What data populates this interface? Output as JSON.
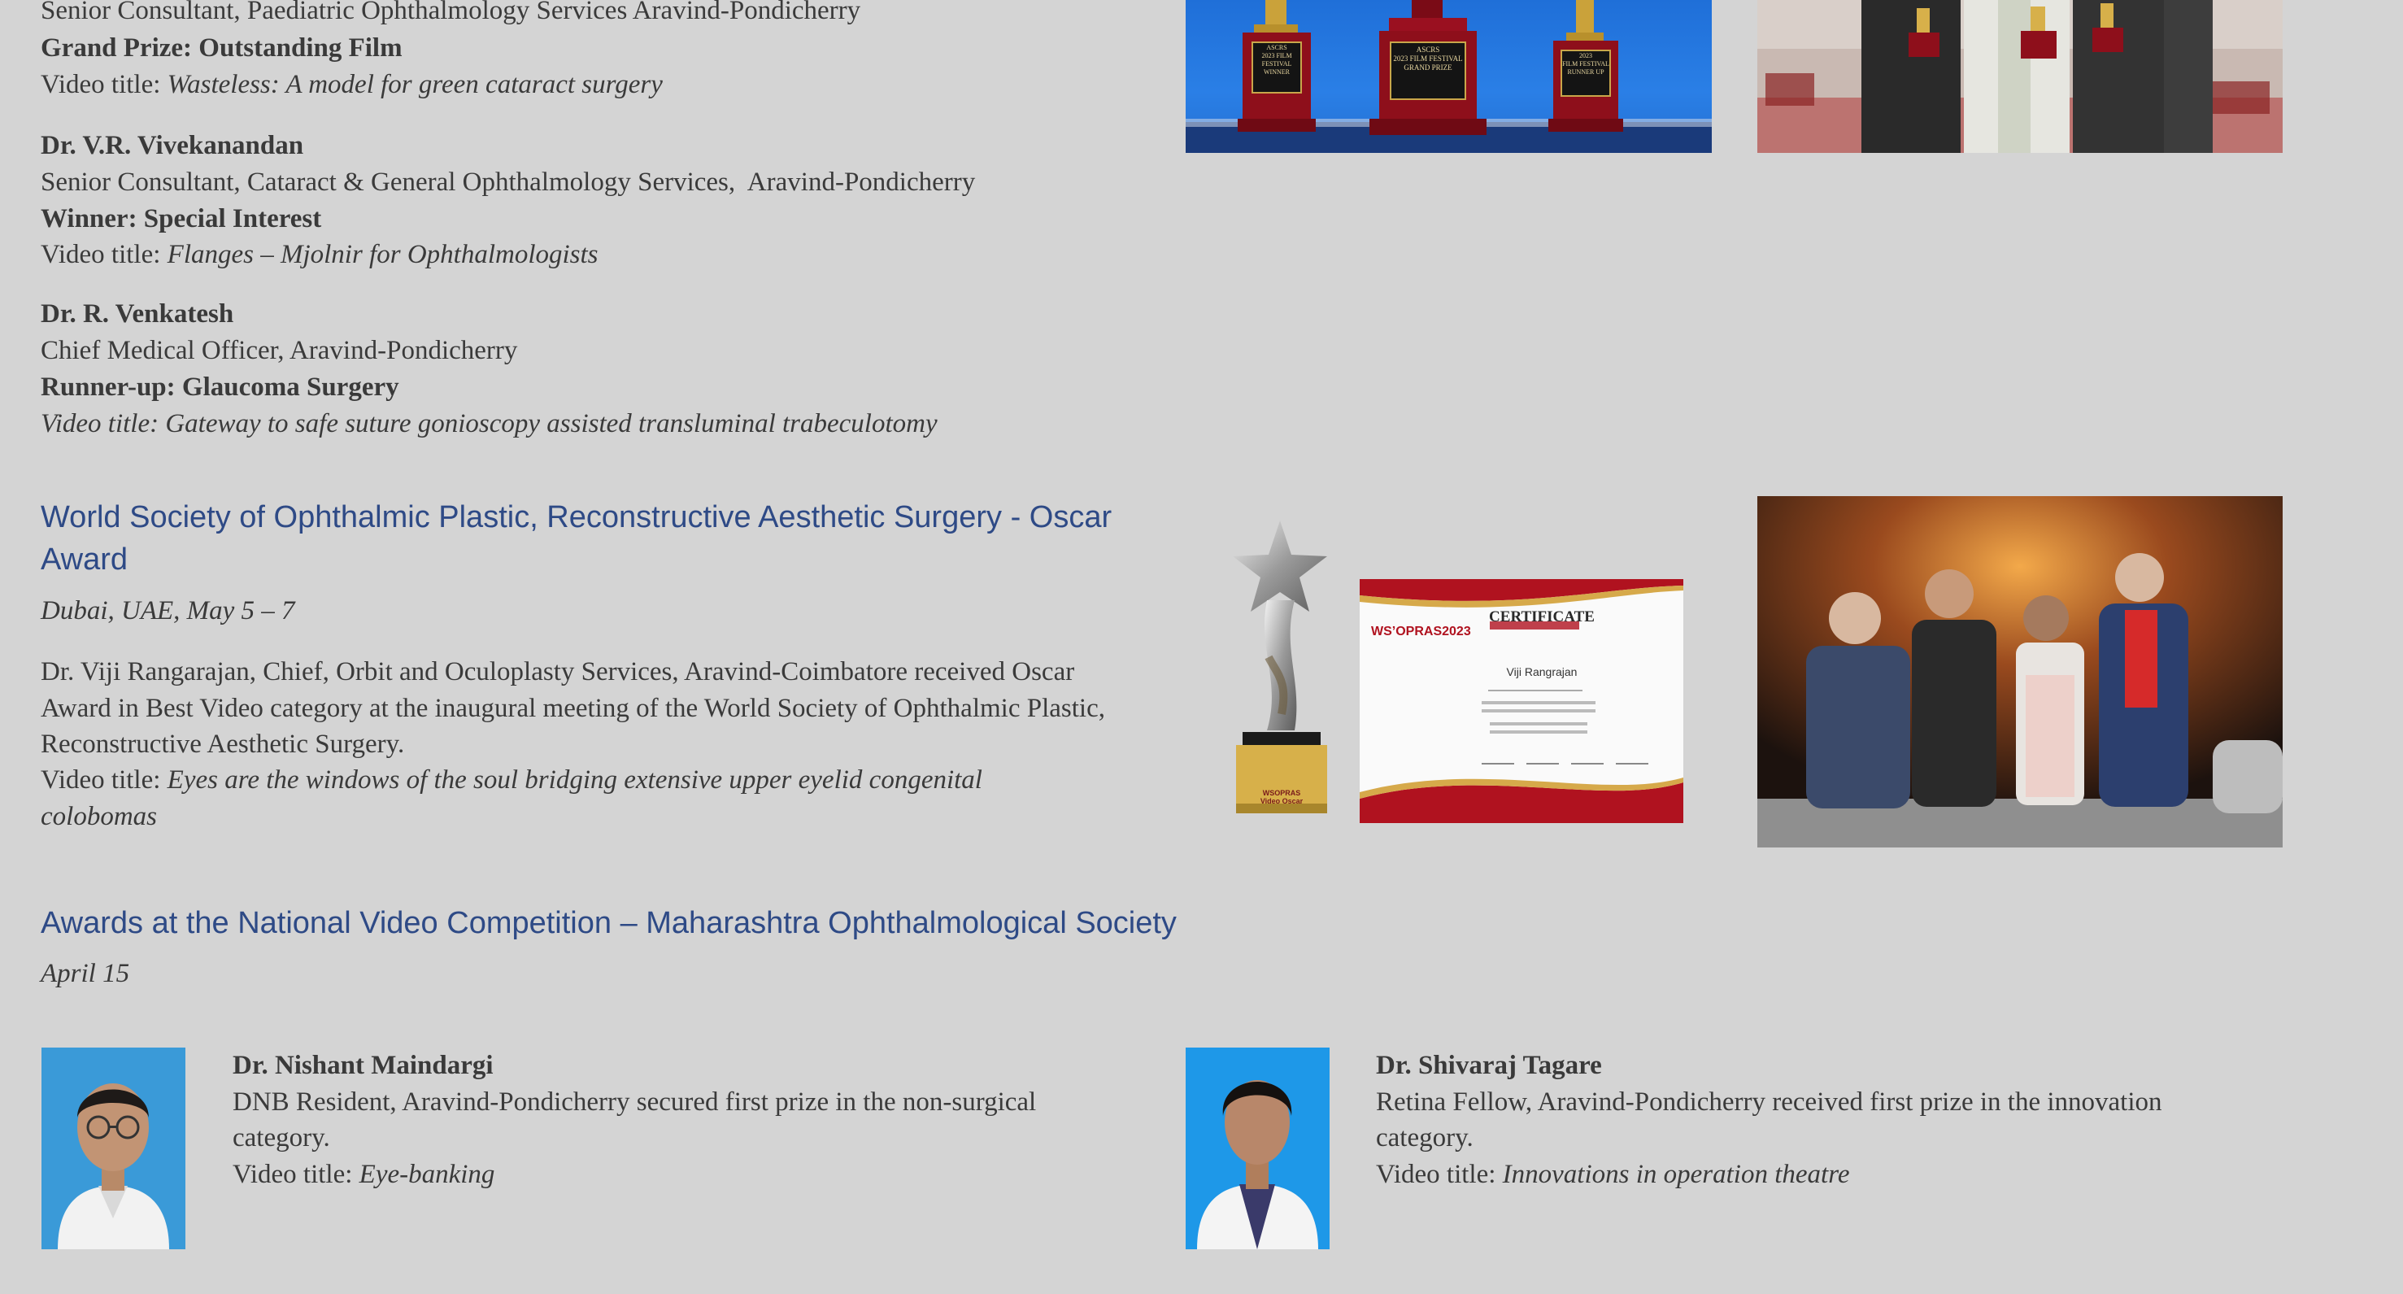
{
  "top_block": {
    "line0": "Senior Consultant, Paediatric Ophthalmology Services Aravind-Pondicherry",
    "prize_label": "Grand Prize: Outstanding Film",
    "video_prefix": "Video title: ",
    "video_title": "Wasteless: A model for green cataract surgery"
  },
  "vivekanandan": {
    "name": "Dr. V.R. Vivekanandan",
    "role": "Senior Consultant, Cataract & General Ophthalmology Services,  Aravind-Pondicherry",
    "prize_label": "Winner: Special Interest",
    "video_prefix": "Video title: ",
    "video_title": "Flanges – Mjolnir for Ophthalmologists"
  },
  "venkatesh": {
    "name": "Dr. R. Venkatesh",
    "role": "Chief Medical Officer, Aravind-Pondicherry",
    "prize_label": "Runner-up: Glaucoma Surgery",
    "video_line": "Video title: Gateway to safe suture gonioscopy assisted transluminal trabeculotomy"
  },
  "trophies_photo": {
    "plaque_left": [
      "ASCRS",
      "2023 FILM FESTIVAL",
      "WINNER"
    ],
    "plaque_center": [
      "ASCRS",
      "2023 FILM FESTIVAL",
      "GRAND PRIZE"
    ],
    "plaque_right": [
      "2023",
      "FILM FESTIVAL",
      "RUNNER UP"
    ]
  },
  "wsoprs": {
    "heading_line1": "World Society of Ophthalmic Plastic, Reconstructive Aesthetic Surgery - Oscar",
    "heading_line2": "Award",
    "place": "Dubai, UAE, May 5 – 7",
    "body": "Dr. Viji Rangarajan, Chief, Orbit and Oculoplasty Services, Aravind-Coimbatore received Oscar Award in Best Video category at the inaugural meeting of the World Society of Ophthalmic Plastic, Reconstructive Aesthetic Surgery.",
    "video_prefix": "Video title: ",
    "video_title": "Eyes are the windows of the soul bridging extensive upper eyelid congenital colobomas",
    "certificate": {
      "logo": "WS’OPRAS2023",
      "title": "CERTIFICATE",
      "recipient": "Viji Rangrajan"
    },
    "trophy_base": [
      "WSOPRAS",
      "Video Oscar"
    ]
  },
  "maharashtra": {
    "heading": "Awards at the National Video Competition – Maharashtra Ophthalmological Society",
    "date": "April 15"
  },
  "maindargi": {
    "name": "Dr. Nishant Maindargi",
    "line1": "DNB Resident, Aravind-Pondicherry secured first prize in the non-surgical",
    "line2": "category.",
    "video_prefix": "Video title: ",
    "video_title": "Eye-banking"
  },
  "tagare": {
    "name": "Dr. Shivaraj Tagare",
    "line1": "Retina Fellow, Aravind-Pondicherry received first prize in the innovation",
    "line2": "category.",
    "video_prefix": "Video title: ",
    "video_title": "Innovations in operation theatre"
  },
  "colors": {
    "background": "#d4d4d4",
    "heading": "#2e4a86",
    "text": "#3a3a3a"
  }
}
